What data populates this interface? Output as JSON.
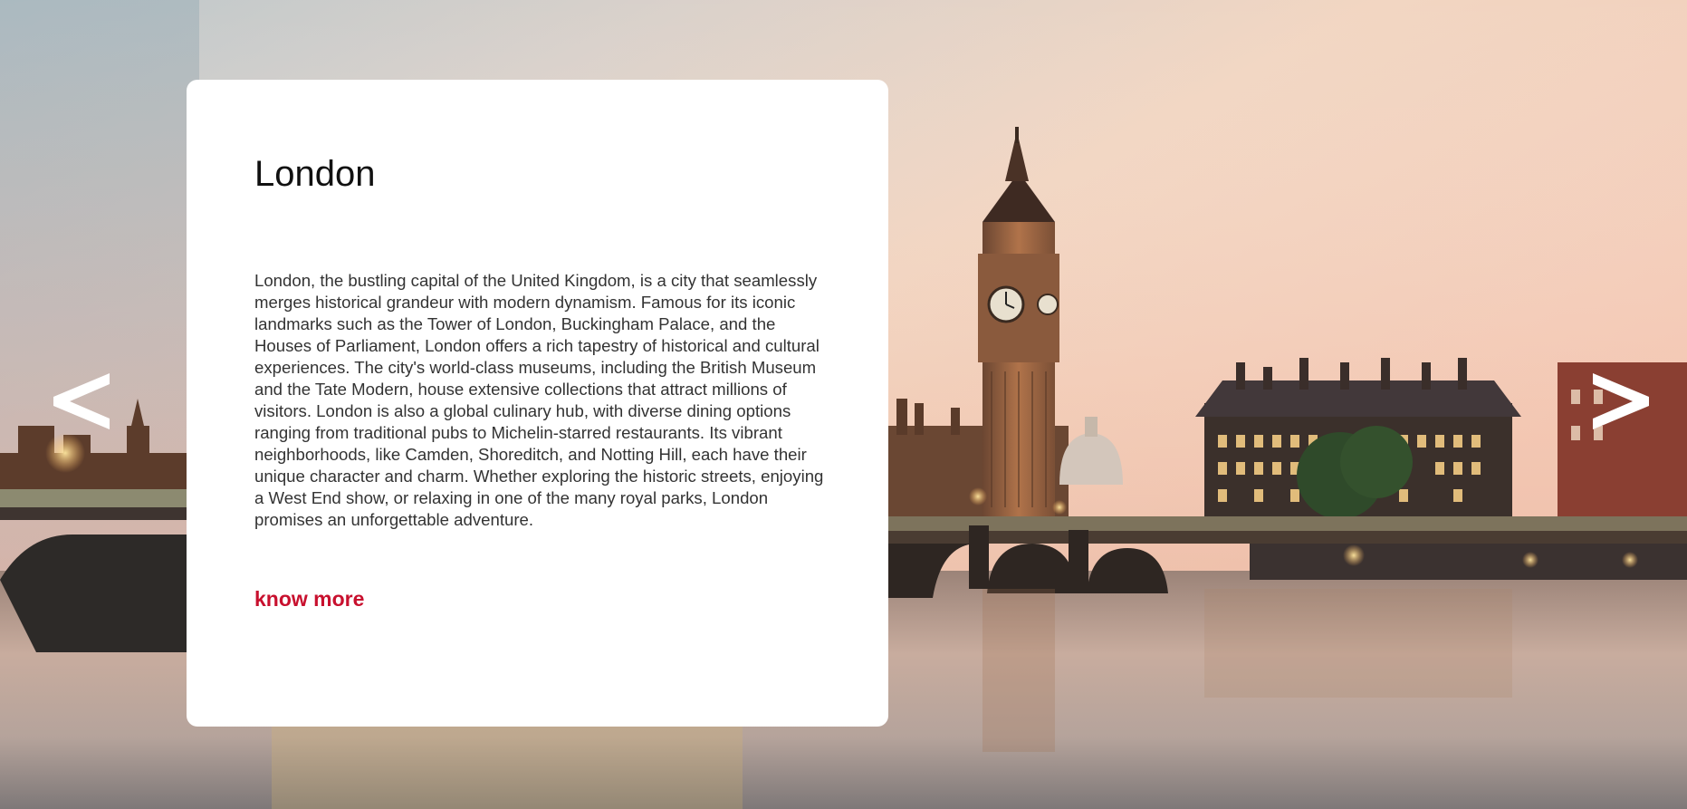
{
  "slide": {
    "title": "London",
    "description": "London, the bustling capital of the United Kingdom, is a city that seamlessly merges historical grandeur with modern dynamism. Famous for its iconic landmarks such as the Tower of London, Buckingham Palace, and the Houses of Parliament, London offers a rich tapestry of historical and cultural experiences. The city's world-class museums, including the British Museum and the Tate Modern, house extensive collections that attract millions of visitors. London is also a global culinary hub, with diverse dining options ranging from traditional pubs to Michelin-starred restaurants. Its vibrant neighborhoods, like Camden, Shoreditch, and Notting Hill, each have their unique character and charm. Whether exploring the historic streets, enjoying a West End show, or relaxing in one of the many royal parks, London promises an unforgettable adventure.",
    "link_label": "know more"
  },
  "nav": {
    "prev_icon": "chevron-left-icon",
    "next_icon": "chevron-right-icon"
  },
  "background": {
    "image_subject": "london-skyline-big-ben-thames-sunset"
  },
  "colors": {
    "accent": "#c8102e",
    "card_bg": "#ffffff",
    "title_text": "#111111",
    "body_text": "#333333",
    "arrow": "#ffffff"
  }
}
